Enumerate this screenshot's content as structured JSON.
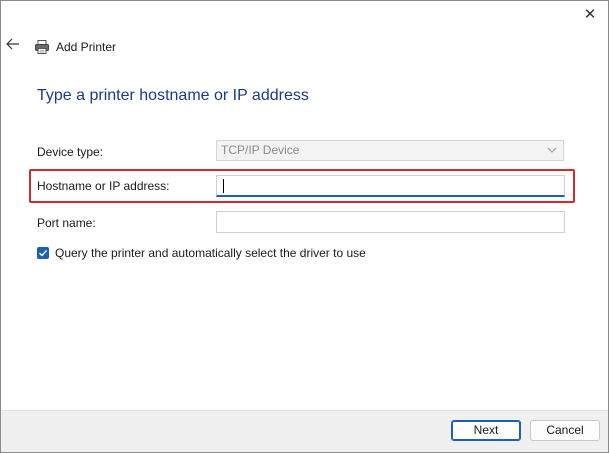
{
  "window": {
    "title": "Add Printer",
    "close_glyph": "✕",
    "back_icon": "back-arrow-icon",
    "printer_icon": "printer-icon"
  },
  "page": {
    "heading": "Type a printer hostname or IP address"
  },
  "form": {
    "device_type_label": "Device type:",
    "device_type_value": "TCP/IP Device",
    "hostname_label": "Hostname or IP address:",
    "hostname_value": "",
    "port_name_label": "Port name:",
    "port_name_value": "",
    "query_checkbox_label": "Query the printer and automatically select the driver to use",
    "query_checked": true
  },
  "footer": {
    "next_label": "Next",
    "cancel_label": "Cancel"
  },
  "colors": {
    "accent": "#1b5fb8",
    "heading": "#1b3a8c",
    "highlight_box": "#d12b2b"
  }
}
